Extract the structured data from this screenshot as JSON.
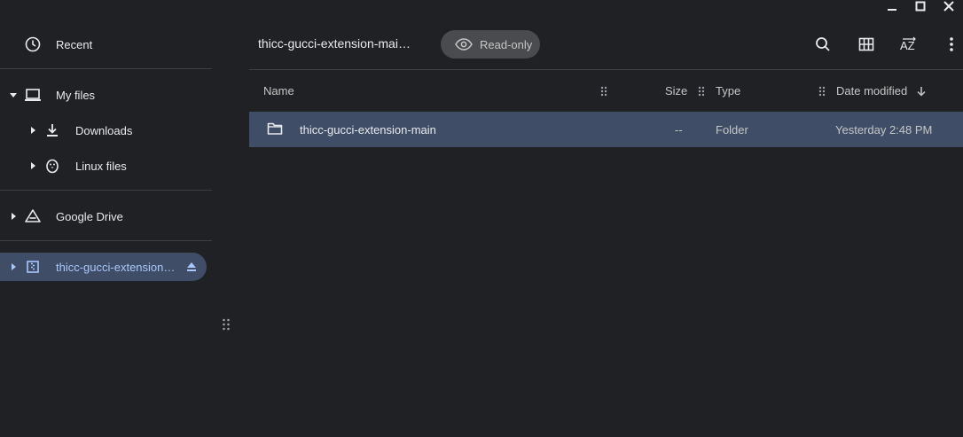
{
  "window": {
    "minimize_icon": "minimize-icon",
    "maximize_icon": "maximize-icon",
    "close_icon": "close-icon"
  },
  "sidebar": {
    "recent": {
      "label": "Recent",
      "icon": "clock-icon"
    },
    "my_files": {
      "label": "My files",
      "icon": "laptop-icon"
    },
    "downloads": {
      "label": "Downloads",
      "icon": "download-icon"
    },
    "linux_files": {
      "label": "Linux files",
      "icon": "penguin-icon"
    },
    "google_drive": {
      "label": "Google Drive",
      "icon": "drive-icon"
    },
    "removable": {
      "label": "thicc-gucci-extension…",
      "icon": "archive-icon",
      "eject_icon": "eject-icon"
    }
  },
  "header": {
    "title": "thicc-gucci-extension-mai…",
    "readonly_label": "Read-only",
    "icons": [
      "search-icon",
      "grid-view-icon",
      "sort-az-icon",
      "more-vert-icon"
    ]
  },
  "table": {
    "columns": {
      "name": "Name",
      "size": "Size",
      "type": "Type",
      "date_modified": "Date modified"
    },
    "sort": {
      "column": "Date modified",
      "direction": "descending"
    },
    "rows": [
      {
        "name": "thicc-gucci-extension-main",
        "size": "--",
        "type": "Folder",
        "date_modified": "Yesterday 2:48 PM",
        "icon": "folder-icon",
        "selected": true
      }
    ]
  },
  "colors": {
    "background": "#202124",
    "selection": "#3f4d67",
    "accent_text": "#a8c7fa",
    "divider": "#3c4043",
    "chip": "#4a4b4e"
  }
}
